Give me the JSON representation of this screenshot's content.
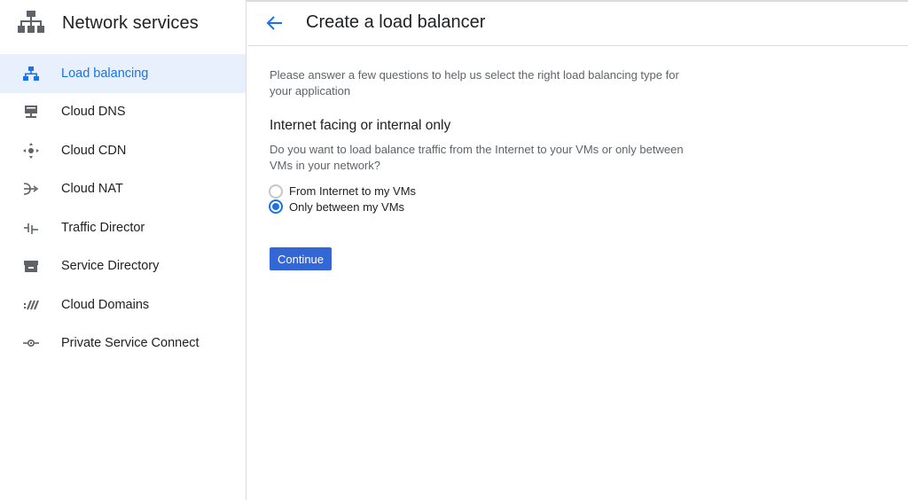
{
  "sidebar": {
    "title": "Network services",
    "logo_icon": "network-hierarchy-icon",
    "items": [
      {
        "label": "Load balancing",
        "icon": "load-balancing-icon",
        "active": true
      },
      {
        "label": "Cloud DNS",
        "icon": "dns-icon",
        "active": false
      },
      {
        "label": "Cloud CDN",
        "icon": "cdn-icon",
        "active": false
      },
      {
        "label": "Cloud NAT",
        "icon": "nat-icon",
        "active": false
      },
      {
        "label": "Traffic Director",
        "icon": "traffic-director-icon",
        "active": false
      },
      {
        "label": "Service Directory",
        "icon": "service-directory-icon",
        "active": false
      },
      {
        "label": "Cloud Domains",
        "icon": "domains-icon",
        "active": false
      },
      {
        "label": "Private Service Connect",
        "icon": "private-service-connect-icon",
        "active": false
      }
    ]
  },
  "header": {
    "title": "Create a load balancer",
    "back_icon": "arrow-back-icon"
  },
  "main": {
    "intro": "Please answer a few questions to help us select the right load balancing type for your application",
    "section_title": "Internet facing or internal only",
    "question": "Do you want to load balance traffic from the Internet to your VMs or only between VMs in your network?",
    "options": [
      {
        "label": "From Internet to my VMs",
        "checked": false
      },
      {
        "label": "Only between my VMs",
        "checked": true
      }
    ],
    "continue_label": "Continue"
  },
  "colors": {
    "accent": "#1a73e8",
    "active_bg": "#e8f0fe",
    "button": "#3367d6",
    "border": "#dadce0",
    "muted_text": "#5f6368"
  }
}
